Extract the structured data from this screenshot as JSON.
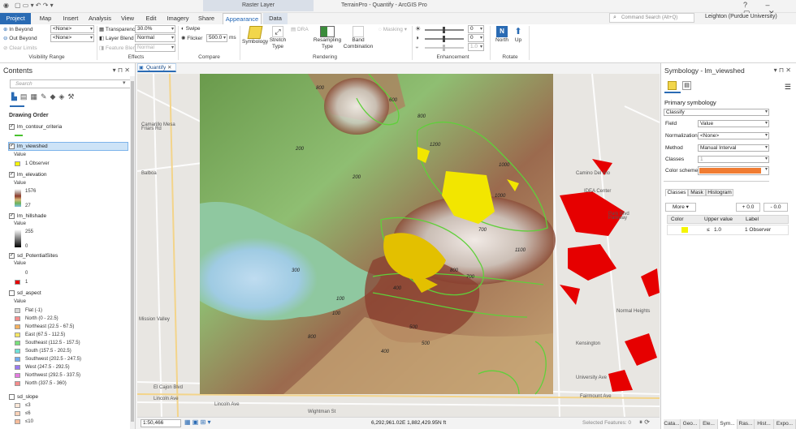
{
  "app": {
    "title": "TerrainPro - Quantify - ArcGIS Pro",
    "context_tab": "Raster Layer",
    "command_search_placeholder": "Command Search (Alt+Q)",
    "user": "Leighton (Purdue University)"
  },
  "tabs": [
    "Project",
    "Map",
    "Insert",
    "Analysis",
    "View",
    "Edit",
    "Imagery",
    "Share",
    "Appearance",
    "Data"
  ],
  "active_tab": "Appearance",
  "ribbon": {
    "visibility_range": {
      "in_beyond": "In Beyond",
      "out_beyond": "Out Beyond",
      "clear_limits": "Clear Limits",
      "in_value": "<None>",
      "out_value": "<None>",
      "group": "Visibility Range"
    },
    "effects": {
      "transparency_label": "Transparency",
      "transparency_value": "30.0%",
      "layer_blend_label": "Layer Blend",
      "layer_blend_value": "Normal",
      "feature_blend_label": "Feature Blend",
      "feature_blend_value": "Normal",
      "group": "Effects"
    },
    "compare": {
      "swipe": "Swipe",
      "flicker": "Flicker",
      "flicker_value": "500.0",
      "flicker_unit": "ms",
      "group": "Compare"
    },
    "rendering": {
      "symbology": "Symbology",
      "stretch_type": "Stretch Type",
      "dra": "DRA",
      "resampling_type": "Resampling Type",
      "band_combination": "Band Combination",
      "masking": "Masking",
      "group": "Rendering"
    },
    "enhancement": {
      "brightness": "0",
      "contrast": "0",
      "gamma": "1.0",
      "group": "Enhancement"
    },
    "rotate": {
      "north": "North",
      "up": "Up",
      "group": "Rotate"
    }
  },
  "contents": {
    "title": "Contents",
    "search_placeholder": "Search",
    "drawing_order": "Drawing Order",
    "layers": [
      {
        "name": "lm_contour_criteria",
        "checked": true
      },
      {
        "name": "lm_viewshed",
        "checked": true,
        "selected": true,
        "value_label": "Value",
        "legend": [
          {
            "label": "1 Observer",
            "color": "#f5f500"
          }
        ]
      },
      {
        "name": "lm_elevation",
        "checked": true,
        "value_label": "Value",
        "high": "1576",
        "low": "27"
      },
      {
        "name": "lm_hillshade",
        "checked": true,
        "value_label": "Value",
        "high": "255",
        "low": "0"
      },
      {
        "name": "sd_PotentialSites",
        "checked": true,
        "value_label": "Value",
        "legend": [
          {
            "label": "0",
            "color": "#ffffff"
          },
          {
            "label": "1",
            "color": "#e60000"
          }
        ]
      },
      {
        "name": "sd_aspect",
        "checked": false,
        "value_label": "Value",
        "legend": [
          {
            "label": "Flat (-1)",
            "color": "#d6d6d6"
          },
          {
            "label": "North (0 - 22.5)",
            "color": "#f58c8c"
          },
          {
            "label": "Northeast (22.5 - 67.5)",
            "color": "#f5b15e"
          },
          {
            "label": "East (67.5 - 112.5)",
            "color": "#f5e664"
          },
          {
            "label": "Southeast (112.5 - 157.5)",
            "color": "#78e07a"
          },
          {
            "label": "South (157.5 - 202.5)",
            "color": "#6fe0d8"
          },
          {
            "label": "Southwest (202.5 - 247.5)",
            "color": "#6eaaf0"
          },
          {
            "label": "West (247.5 - 292.5)",
            "color": "#9a78f0"
          },
          {
            "label": "Northwest (292.5 - 337.5)",
            "color": "#e47ae0"
          },
          {
            "label": "North (337.5 - 360)",
            "color": "#f58c8c"
          }
        ]
      },
      {
        "name": "sd_slope",
        "checked": false,
        "legend": [
          {
            "label": "≤3",
            "color": "#fde8d8"
          },
          {
            "label": "≤6",
            "color": "#fbd3b9"
          },
          {
            "label": "≤10",
            "color": "#f8bd9b"
          }
        ]
      }
    ]
  },
  "map": {
    "tab_label": "Quantify",
    "scale": "1:50,466",
    "coordinates": "6,292,961.02E 1,882,429.95N ft",
    "selected_features": "Selected Features: 0",
    "contour_labels": [
      "800",
      "600",
      "800",
      "200",
      "1200",
      "1000",
      "1000",
      "700",
      "1100",
      "800",
      "700",
      "200",
      "300",
      "400",
      "100",
      "100",
      "500",
      "500",
      "800",
      "400"
    ],
    "street_labels": [
      "El Cajon Blvd",
      "Lincoln Ave",
      "Lincoln Ave",
      "University Ave",
      "Wightman St",
      "Fairmount Ave",
      "Balboa",
      "Camino Del Rio",
      "Friars Rd",
      "Mission Valley",
      "IDEA Center",
      "Parkway",
      "Park Blvd",
      "Camarillo Mesa",
      "Kensington",
      "Normal Heights"
    ]
  },
  "symbology": {
    "title": "Symbology - lm_viewshed",
    "primary": "Primary symbology",
    "method_combo": "Classify",
    "field_label": "Field",
    "field_value": "Value",
    "normalization_label": "Normalization",
    "normalization_value": "<None>",
    "method_label": "Method",
    "method_value": "Manual Interval",
    "classes_label": "Classes",
    "classes_value": "1",
    "color_scheme_label": "Color scheme",
    "color_scheme": "#f07c32",
    "tabs": [
      "Classes",
      "Mask",
      "Histogram"
    ],
    "more": "More",
    "plus": "+ 0.0",
    "minus": "- 0.0",
    "table_headers": [
      "Color",
      "Upper value",
      "Label"
    ],
    "row": {
      "color": "#f5f500",
      "op": "≤",
      "upper": "1.0",
      "label": "1 Observer"
    }
  },
  "bottom_tabs": [
    "Cata...",
    "Geo...",
    "Ele...",
    "Sym...",
    "Ras...",
    "Hist...",
    "Expo..."
  ]
}
